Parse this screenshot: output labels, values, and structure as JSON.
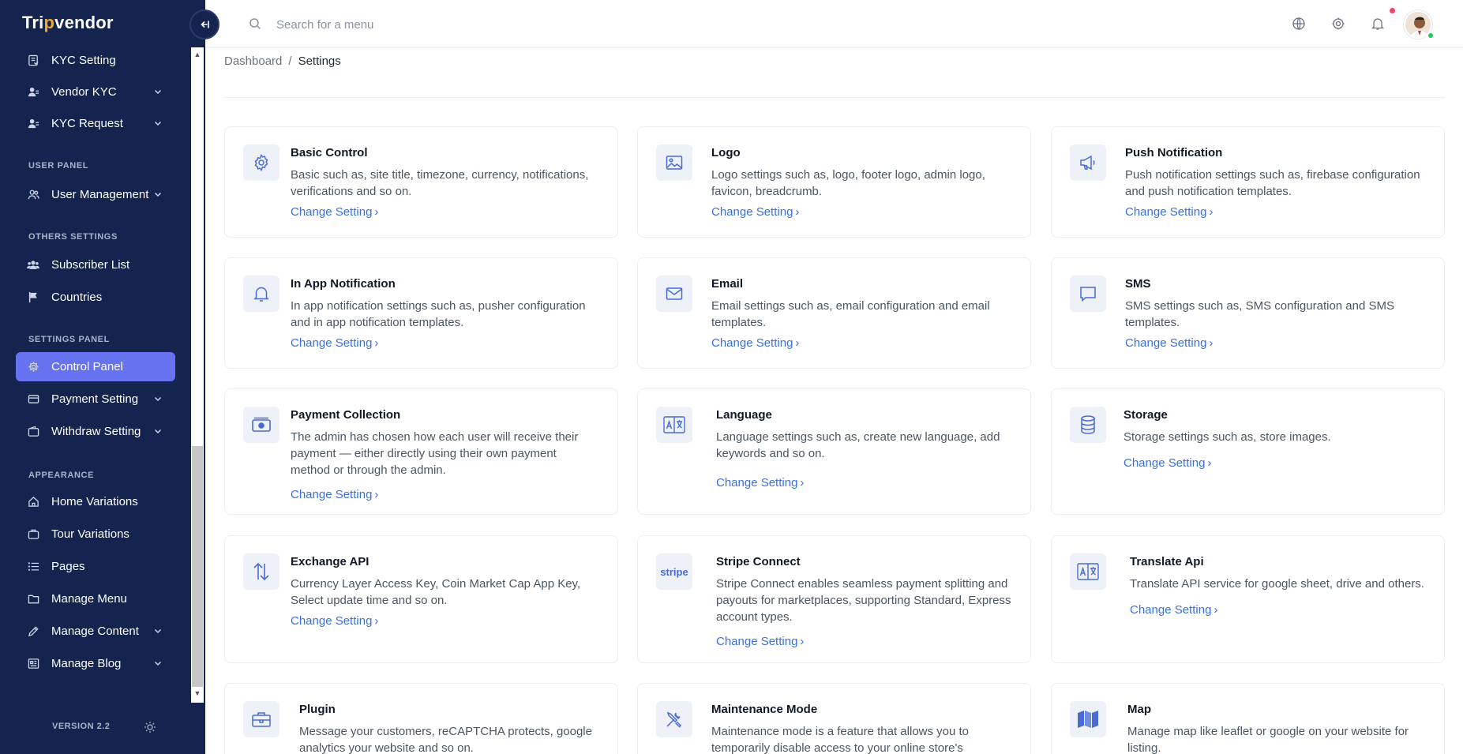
{
  "brand": {
    "name_part1": "Tri",
    "name_part2": "p",
    "name_part3": "vendor"
  },
  "sidebar": {
    "items": [
      {
        "label": "KYC Setting",
        "icon": "kyc-icon",
        "has_chevron": false
      },
      {
        "label": "Vendor KYC",
        "icon": "users-icon",
        "has_chevron": true
      },
      {
        "label": "KYC Request",
        "icon": "users-icon",
        "has_chevron": true
      },
      {
        "label": "User Management",
        "icon": "users-icon",
        "has_chevron": true
      },
      {
        "label": "Subscriber List",
        "icon": "group-icon",
        "has_chevron": false
      },
      {
        "label": "Countries",
        "icon": "flag-icon",
        "has_chevron": false
      },
      {
        "label": "Control Panel",
        "icon": "gear-icon",
        "has_chevron": false,
        "active": true
      },
      {
        "label": "Payment Setting",
        "icon": "card-icon",
        "has_chevron": true
      },
      {
        "label": "Withdraw Setting",
        "icon": "wallet-icon",
        "has_chevron": true
      },
      {
        "label": "Home Variations",
        "icon": "home-icon",
        "has_chevron": false
      },
      {
        "label": "Tour Variations",
        "icon": "bag-icon",
        "has_chevron": false
      },
      {
        "label": "Pages",
        "icon": "list-icon",
        "has_chevron": false
      },
      {
        "label": "Manage Menu",
        "icon": "folder-icon",
        "has_chevron": false
      },
      {
        "label": "Manage Content",
        "icon": "pencil-icon",
        "has_chevron": true
      },
      {
        "label": "Manage Blog",
        "icon": "blog-icon",
        "has_chevron": true
      }
    ],
    "sections": {
      "user_panel": "USER PANEL",
      "others_settings": "OTHERS SETTINGS",
      "settings_panel": "SETTINGS PANEL",
      "appearance": "APPEARANCE"
    },
    "version": "VERSION 2.2"
  },
  "topbar": {
    "search_placeholder": "Search for a menu"
  },
  "breadcrumb": {
    "home": "Dashboard",
    "separator": "/",
    "current": "Settings"
  },
  "link_label": "Change Setting",
  "cards": [
    {
      "title": "Basic Control",
      "desc_lines": [
        "Basic such as, site title, timezone, currency, notifications,",
        "verifications and so on."
      ],
      "icon": "gear-icon"
    },
    {
      "title": "Logo",
      "desc_lines": [
        "Logo settings such as, logo, footer logo, admin logo,",
        "favicon, breadcrumb."
      ],
      "icon": "image-icon"
    },
    {
      "title": "Push Notification",
      "desc_lines": [
        "Push notification settings such as, firebase configuration",
        "and push notification templates."
      ],
      "icon": "megaphone-icon"
    },
    {
      "title": "In App Notification",
      "desc_lines": [
        "In app notification settings such as, pusher configuration",
        "and in app notification templates."
      ],
      "icon": "bell-icon"
    },
    {
      "title": "Email",
      "desc_lines": [
        "Email settings such as, email configuration and email",
        "templates."
      ],
      "icon": "mail-icon"
    },
    {
      "title": "SMS",
      "desc_lines": [
        "SMS settings such as, SMS configuration and SMS",
        "templates."
      ],
      "icon": "chat-icon"
    },
    {
      "title": "Payment Collection",
      "desc_lines": [
        "The admin has chosen how each user will receive their",
        "payment — either directly using their own payment",
        "method or through the admin."
      ],
      "icon": "money-icon"
    },
    {
      "title": "Language",
      "desc_lines": [
        "Language settings such as, create new language, add",
        "keywords and so on."
      ],
      "icon": "translate-icon"
    },
    {
      "title": "Storage",
      "desc_lines": [
        "Storage settings such as, store images."
      ],
      "icon": "database-icon"
    },
    {
      "title": "Exchange API",
      "desc_lines": [
        "Currency Layer Access Key, Coin Market Cap App Key,",
        "Select update time and so on."
      ],
      "icon": "exchange-icon"
    },
    {
      "title": "Stripe Connect",
      "desc_lines": [
        "Stripe Connect enables seamless payment splitting and",
        "payouts for marketplaces, supporting Standard, Express",
        "account types."
      ],
      "icon": "stripe-icon",
      "icon_text": "stripe"
    },
    {
      "title": "Translate Api",
      "desc_lines": [
        "Translate API service for google sheet, drive and others."
      ],
      "icon": "translate-icon"
    },
    {
      "title": "Plugin",
      "desc_lines": [
        "Message your customers, reCAPTCHA protects, google",
        "analytics your website and so on."
      ],
      "icon": "toolbox-icon"
    },
    {
      "title": "Maintenance Mode",
      "desc_lines": [
        "Maintenance mode is a feature that allows you to",
        "temporarily disable access to your online store's"
      ],
      "icon": "tools-icon"
    },
    {
      "title": "Map",
      "desc_lines": [
        "Manage map like leaflet or google on your website for",
        "listing."
      ],
      "icon": "map-icon"
    }
  ],
  "colors": {
    "sidebar_bg": "#14244f",
    "active_item": "#6672f0",
    "link": "#3b6fe0",
    "icon": "#4a6bd6"
  }
}
